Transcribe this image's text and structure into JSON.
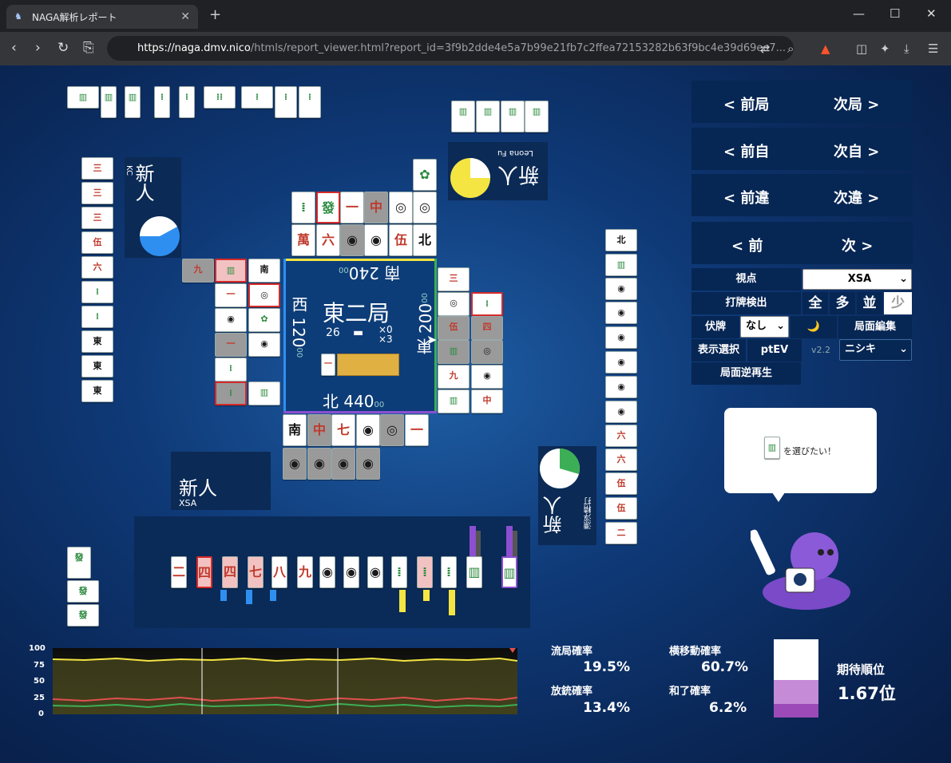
{
  "browser": {
    "tab_title": "NAGA解析レポート",
    "url_host": "https://naga.dmv.nico",
    "url_rest": "/htmls/report_viewer.html?report_id=3f9b2dde4e5a7b99e21fb7c2ffea72153282b63f9bc4e39d69ee7..."
  },
  "board": {
    "round": "東二局",
    "honba": "26",
    "sticks_a": "×0",
    "sticks_b": "×3",
    "seat_south": "南",
    "score_south": "240",
    "seat_west": "西",
    "score_west": "120",
    "seat_east": "東",
    "score_east": "200",
    "seat_north": "北",
    "score_north": "440",
    "score_suffix": "00",
    "dora_tile": "一"
  },
  "players": {
    "top": {
      "name": "新人",
      "sub": "Leona Fu"
    },
    "left": {
      "name": "新人",
      "sub": "KC"
    },
    "right": {
      "name": "新人",
      "sub": "漂浮精打"
    },
    "self": {
      "name": "新人",
      "sub": "XSA"
    }
  },
  "controls": {
    "prev_round": "< 前局",
    "next_round": "次局 >",
    "prev_self": "< 前自",
    "next_self": "次自 >",
    "prev_diff": "< 前違",
    "next_diff": "次違 >",
    "prev": "< 前",
    "next": "次 >",
    "viewpoint_label": "視点",
    "viewpoint_value": "XSA",
    "detect_label": "打牌検出",
    "detect_all": "全",
    "detect_many": "多",
    "detect_normal": "並",
    "detect_few": "少",
    "hidden_label": "伏牌",
    "hidden_value": "なし",
    "moon": "🌙",
    "edit_label": "局面編集",
    "display_label": "表示選択",
    "display_value": "ptEV",
    "version": "v2.2",
    "model_value": "ニシキ",
    "replay_label": "局面逆再生"
  },
  "bubble_text": "を選びたい！",
  "stats": {
    "ryukyoku_label": "流局確率",
    "ryukyoku": "19.5%",
    "yoko_label": "横移動確率",
    "yoko": "60.7%",
    "houju_label": "放銃確率",
    "houju": "13.4%",
    "agari_label": "和了確率",
    "agari": "6.2%",
    "rank_label": "期待順位",
    "rank": "1.67位"
  },
  "graph": {
    "y_ticks": [
      "100",
      "75",
      "50",
      "25",
      "0"
    ]
  },
  "colors": {
    "accent": "#0d3d78",
    "gauge_yellow": "#f4e542",
    "gauge_blue": "#2e8ff0",
    "gauge_green": "#3cae55"
  }
}
